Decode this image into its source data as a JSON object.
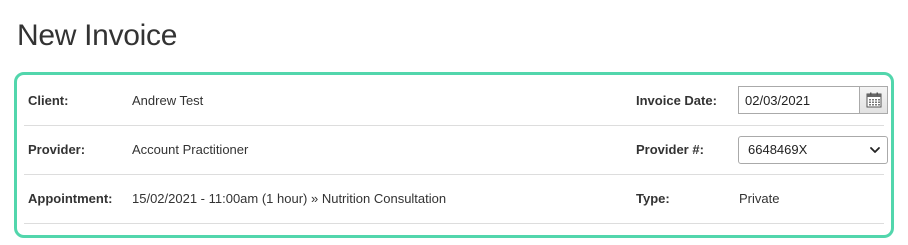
{
  "page": {
    "title": "New Invoice"
  },
  "invoice": {
    "client_label": "Client:",
    "client_value": "Andrew Test",
    "invoice_date_label": "Invoice Date:",
    "invoice_date_value": "02/03/2021",
    "provider_label": "Provider:",
    "provider_value": "Account Practitioner",
    "provider_num_label": "Provider #:",
    "provider_num_value": "6648469X",
    "appointment_label": "Appointment:",
    "appointment_value": "15/02/2021 - 11:00am (1 hour) » Nutrition Consultation",
    "type_label": "Type:",
    "type_value": "Private"
  },
  "colors": {
    "panel_border": "#52d6ac",
    "text": "#333333",
    "divider": "#dddddd"
  },
  "icons": {
    "calendar": "calendar-icon",
    "chevron": "chevron-down-icon"
  }
}
